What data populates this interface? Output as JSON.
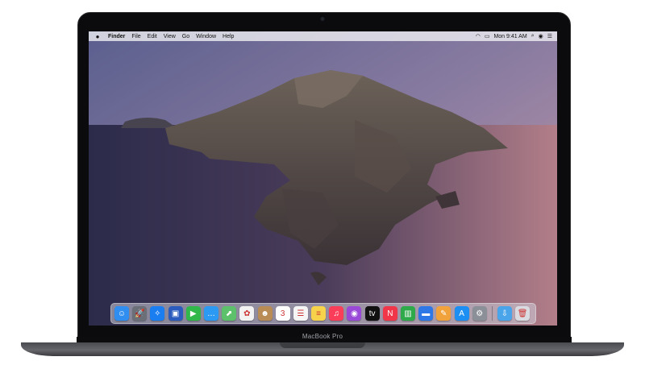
{
  "device": {
    "label": "MacBook Pro"
  },
  "menubar": {
    "items": [
      "Finder",
      "File",
      "Edit",
      "View",
      "Go",
      "Window",
      "Help"
    ],
    "clock": "Mon 9:41 AM"
  },
  "dock": {
    "apps": [
      {
        "name": "Finder",
        "icon": "finder-icon",
        "color": "#2f8ef0",
        "glyph": "☺"
      },
      {
        "name": "Launchpad",
        "icon": "rocket-icon",
        "color": "#6b6f78",
        "glyph": "🚀"
      },
      {
        "name": "Safari",
        "icon": "compass-icon",
        "color": "#1a7df0",
        "glyph": "✧"
      },
      {
        "name": "Photo Booth",
        "icon": "photo-icon",
        "color": "#2b5bbd",
        "glyph": "▣"
      },
      {
        "name": "FaceTime",
        "icon": "video-icon",
        "color": "#31b84b",
        "glyph": "▶"
      },
      {
        "name": "Messages",
        "icon": "chat-icon",
        "color": "#2c9af2",
        "glyph": "…"
      },
      {
        "name": "Maps",
        "icon": "map-icon",
        "color": "#5dc06b",
        "glyph": "⬈"
      },
      {
        "name": "Photos",
        "icon": "flower-icon",
        "color": "#f2f2f2",
        "glyph": "✿"
      },
      {
        "name": "Contacts",
        "icon": "contacts-icon",
        "color": "#b98b55",
        "glyph": "☻"
      },
      {
        "name": "Calendar",
        "icon": "calendar-icon",
        "color": "#ffffff",
        "glyph": "3"
      },
      {
        "name": "Reminders",
        "icon": "list-icon",
        "color": "#f5f5f5",
        "glyph": "☰"
      },
      {
        "name": "Notes",
        "icon": "note-icon",
        "color": "#f6d34b",
        "glyph": "≡"
      },
      {
        "name": "Music",
        "icon": "music-icon",
        "color": "#fa3e5a",
        "glyph": "♫"
      },
      {
        "name": "Podcasts",
        "icon": "podcast-icon",
        "color": "#9a48d8",
        "glyph": "◉"
      },
      {
        "name": "TV",
        "icon": "tv-icon",
        "color": "#111111",
        "glyph": "tv"
      },
      {
        "name": "News",
        "icon": "news-icon",
        "color": "#f1364a",
        "glyph": "N"
      },
      {
        "name": "Numbers",
        "icon": "chart-icon",
        "color": "#2faa4a",
        "glyph": "▥"
      },
      {
        "name": "Keynote",
        "icon": "keynote-icon",
        "color": "#2d77e6",
        "glyph": "▬"
      },
      {
        "name": "Pages",
        "icon": "pages-icon",
        "color": "#f2a23a",
        "glyph": "✎"
      },
      {
        "name": "App Store",
        "icon": "appstore-icon",
        "color": "#1e8ff2",
        "glyph": "A"
      },
      {
        "name": "System Preferences",
        "icon": "gear-icon",
        "color": "#8b8f97",
        "glyph": "⚙"
      },
      {
        "name": "Downloads",
        "icon": "folder-icon",
        "color": "#4aa4ea",
        "glyph": "⇩"
      },
      {
        "name": "Trash",
        "icon": "trash-icon",
        "color": "#d9dbe0",
        "glyph": "🗑"
      }
    ]
  }
}
